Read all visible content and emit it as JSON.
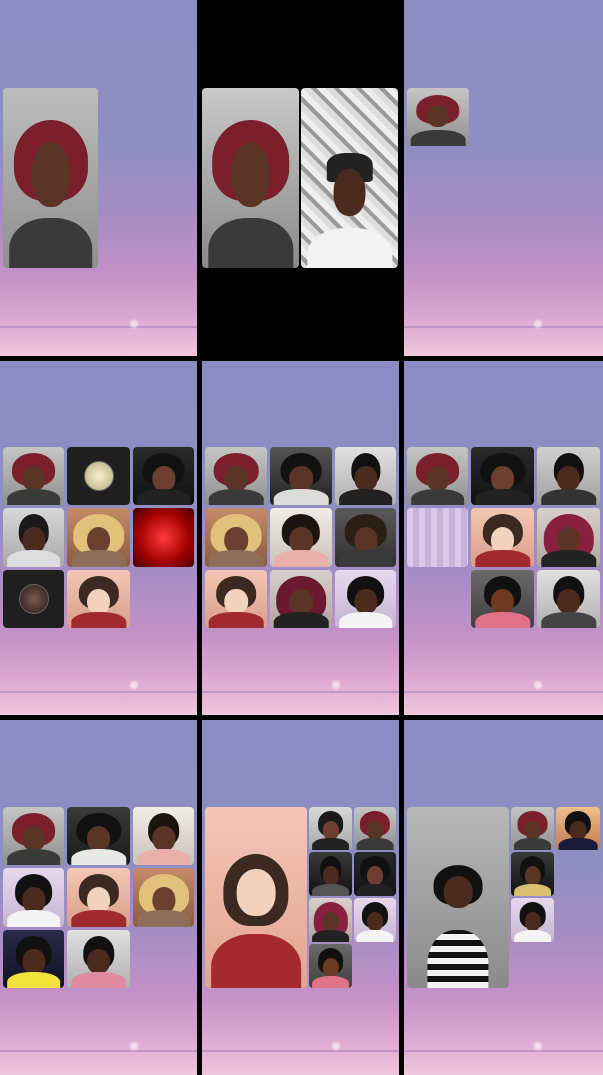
{
  "screen": {
    "title": "",
    "background_top": "#8a8dc2",
    "background_bottom": "#f0c8db"
  },
  "panels": [
    {
      "id": "p1",
      "participants": [
        "participant-1"
      ]
    },
    {
      "id": "p2",
      "participants": [
        "participant-1",
        "participant-2"
      ]
    },
    {
      "id": "p3",
      "participants": [
        "participant-1"
      ]
    },
    {
      "id": "p4",
      "participants": [
        "participant-1",
        "participant-avatar-1",
        "participant-3",
        "participant-4",
        "participant-5",
        "participant-camera-red",
        "participant-avatar-2",
        "participant-6"
      ]
    },
    {
      "id": "p5",
      "participants": [
        "participant-1",
        "participant-7",
        "participant-4",
        "participant-5",
        "participant-8",
        "participant-9",
        "participant-6",
        "participant-10",
        "participant-11"
      ]
    },
    {
      "id": "p6",
      "participants": [
        "participant-1",
        "participant-3",
        "participant-12",
        "participant-13",
        "participant-6",
        "participant-14",
        "participant-15",
        "participant-16"
      ]
    },
    {
      "id": "p7",
      "participants": [
        "participant-1",
        "participant-17",
        "participant-12",
        "participant-11",
        "participant-6",
        "participant-5",
        "participant-18",
        "participant-15"
      ]
    },
    {
      "id": "p8",
      "participants": [
        "participant-6",
        "participant-1",
        "participant-19",
        "participant-3",
        "participant-20",
        "participant-14",
        "participant-11",
        "participant-15"
      ]
    },
    {
      "id": "p9",
      "participants": [
        "participant-21",
        "participant-1",
        "participant-22",
        "participant-20",
        "participant-11"
      ]
    }
  ]
}
